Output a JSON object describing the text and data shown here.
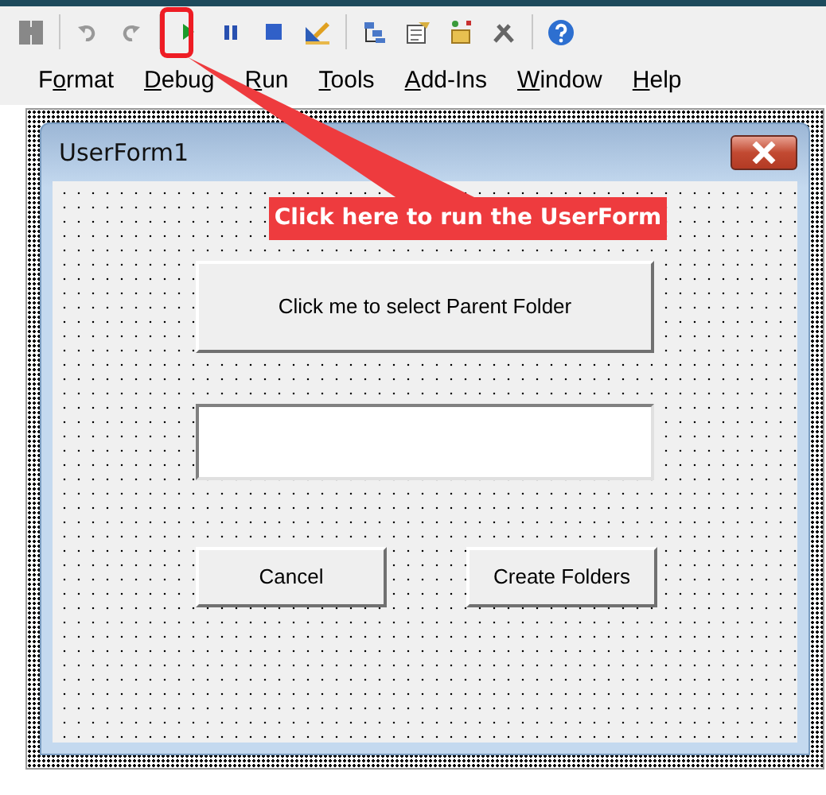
{
  "menu": [
    {
      "pre": "F",
      "key": "o",
      "post": "rmat"
    },
    {
      "key": "D",
      "post": "ebug"
    },
    {
      "key": "R",
      "post": "un"
    },
    {
      "key": "T",
      "post": "ools"
    },
    {
      "key": "A",
      "post": "dd-Ins"
    },
    {
      "key": "W",
      "post": "indow"
    },
    {
      "key": "H",
      "post": "elp"
    }
  ],
  "userform": {
    "title": "UserForm1",
    "controls": [
      {
        "kind": "button",
        "label": "Click me to select Parent Folder"
      },
      {
        "kind": "textbox"
      },
      {
        "kind": "button",
        "label": "Cancel"
      },
      {
        "kind": "button",
        "label": "Create Folders"
      }
    ]
  },
  "annotation": {
    "callout": "Click here to run the UserForm",
    "highlight_run": true
  }
}
